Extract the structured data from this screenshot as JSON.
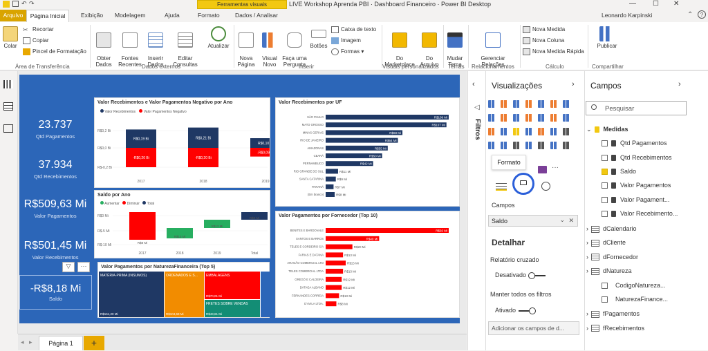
{
  "window": {
    "title": "LIVE Workshop Aprenda PBI · Dashboard Financeiro · Power BI Desktop",
    "context_tab": "Ferramentas visuais",
    "user": "Leonardo Karpinski"
  },
  "tabs": [
    "Arquivo",
    "Página Inicial",
    "Exibição",
    "Modelagem",
    "Ajuda",
    "Formato",
    "Dados / Analisar"
  ],
  "ribbon": {
    "paste": "Colar",
    "cut": "Recortar",
    "copy": "Copiar",
    "format_painter": "Pincel de Formatação",
    "get_data": "Obter\nDados",
    "recent_sources": "Fontes\nRecentes",
    "enter_data": "Inserir\nDados",
    "edit_queries": "Editar\nConsultas",
    "refresh": "Atualizar",
    "new_page": "Nova\nPágina",
    "new_visual": "Visual\nNovo",
    "ask_question": "Faça uma\nPergunta",
    "buttons": "Botões",
    "text_box": "Caixa de texto",
    "image": "Imagem",
    "shapes": "Formas",
    "from_marketplace": "Do\nMarketplace",
    "from_file": "Do\nArquivo",
    "switch_theme": "Mudar\nTema",
    "manage_relationships": "Gerenciar\nRelações",
    "new_measure": "Nova Medida",
    "new_column": "Nova Coluna",
    "quick_measure": "Nova Medida Rápida",
    "publish": "Publicar",
    "groups": [
      "Área de Transferência",
      "Dados externos",
      "Inserir",
      "Visuais personalizados",
      "Temas",
      "Relacionamentos",
      "Cálculo",
      "Compartilhar"
    ]
  },
  "kpis": [
    {
      "value": "23.737",
      "label": "Qtd Pagamentos"
    },
    {
      "value": "37.934",
      "label": "Qtd Recebimentos"
    },
    {
      "value": "R$509,63 Mi",
      "label": "Valor Pagamentos"
    },
    {
      "value": "R$501,45 Mi",
      "label": "Valor Recebimentos"
    },
    {
      "value": "-R$8,18 Mi",
      "label": "Saldo"
    }
  ],
  "chart_data": [
    {
      "type": "bar",
      "title": "Valor Recebimentos e Valor Pagamentos Negativo por Ano",
      "categories": [
        "2017",
        "2018",
        "2019"
      ],
      "legend": [
        "Valor Recebimentos",
        "Valor Pagamentos Negativo"
      ],
      "series": [
        {
          "name": "Valor Recebimentos",
          "values": [
            0.19,
            0.21,
            0.1
          ],
          "labels": [
            "R$0,19 Bi",
            "R$0,21 Bi",
            "R$0,10 Bi"
          ],
          "color": "#1f3864"
        },
        {
          "name": "Valor Pagamentos Negativo",
          "values": [
            -0.2,
            -0.2,
            -0.09
          ],
          "labels": [
            "-R$0,20 Bi",
            "-R$0,20 Bi",
            "-R$0,09 Bi"
          ],
          "color": "#ff0000"
        }
      ],
      "yticks": [
        "R$0,2 Bi",
        "R$0,0 Bi",
        "R$-0,2 Bi"
      ]
    },
    {
      "type": "bar",
      "title": "Valor Recebimentos por UF",
      "orientation": "horizontal",
      "categories": [
        "SÃO PAULO",
        "MATO GROSSO",
        "MINAS GERAIS",
        "RIO DE JANEIRO",
        "AMAZONAS",
        "CEARÁ",
        "PERNAMBUCO",
        "RIO GRANDE DO SUL",
        "SANTA CATARINA",
        "PARANÁ",
        "(Em branco)"
      ],
      "values": [
        109,
        107,
        68,
        64,
        55,
        50,
        42,
        11,
        9,
        7,
        8
      ],
      "labels": [
        "R$109 Mi",
        "R$107 Mi",
        "R$68 Mi",
        "R$64 Mi",
        "R$55 Mi",
        "R$50 Mi",
        "R$42 Mi",
        "R$11 Mi",
        "R$9 Mi",
        "R$7 Mi",
        "R$8 Mi"
      ],
      "color": "#1f3864"
    },
    {
      "type": "waterfall",
      "title": "Saldo por Ano",
      "legend": [
        "Aumentar",
        "Diminuir",
        "Total"
      ],
      "categories": [
        "2017",
        "2018",
        "2019",
        "Total"
      ],
      "yticks": [
        "R$0 Mi",
        "R$-5 Mi",
        "R$-10 Mi"
      ],
      "labels": [
        "R$8 Mi",
        "R$13 Mi",
        "R$13 Mi",
        "R$8 Mi"
      ]
    },
    {
      "type": "bar",
      "title": "Valor Pagamentos por Fornecedor (Top 10)",
      "orientation": "horizontal",
      "categories": [
        "BENITES E BARDOVALE",
        "SANTOS E BARROS",
        "TELES E CORDEIRO S/A",
        "FARIAS E DATANA",
        "ARAGÃO COMERCIAL LTD",
        "TELES COMERCIAL LTDA",
        "GREGÓ E CALDEIRA",
        "DATAGA ALBANO",
        "FERNANDES CORREIA",
        "D'AVILA LTDA."
      ],
      "values": [
        92,
        40,
        20,
        13,
        15,
        13,
        12,
        12,
        10,
        8
      ],
      "labels": [
        "R$92 Mi",
        "R$40 Mi",
        "R$20 Mi",
        "R$13 Mi",
        "R$15 Mi",
        "R$13 Mi",
        "R$12 Mi",
        "R$12 Mi",
        "R$10 Mi",
        "R$8 Mi"
      ],
      "color": "#ff0000"
    },
    {
      "type": "treemap",
      "title": "Valor Pagamentos por NaturezaFinanceira (Top 5)",
      "items": [
        {
          "label": "MATÉRIA-PRIMA (INSUMOS)",
          "value": "R$161,20 Mi",
          "color": "#1f3864"
        },
        {
          "label": "ORDENADOS E S...",
          "value": "R$104,69 Mi",
          "color": "#f28c00"
        },
        {
          "label": "EMBALAGENS",
          "value": "R$70,01 Mi",
          "color": "#ff0000"
        },
        {
          "label": "FRETES SOBRE VENDAS",
          "value": "R$43,61 Mi",
          "color": "#138d75"
        },
        {
          "label": "",
          "value": "",
          "color": "#2c66b8"
        }
      ]
    }
  ],
  "page_tab": "Página 1",
  "add_page": "+",
  "filters_label": "Filtros",
  "viz_pane": {
    "title": "Visualizações",
    "tooltip": "Formato",
    "fields_label": "Campos",
    "field_value": "Saldo",
    "drill_title": "Detalhar",
    "cross_report": "Relatório cruzado",
    "cross_state": "Desativado",
    "keep_filters": "Manter todos os filtros",
    "keep_state": "Ativado",
    "add_drill": "Adicionar os campos de d..."
  },
  "fields_pane": {
    "title": "Campos",
    "search_placeholder": "Pesquisar",
    "items": [
      {
        "type": "group",
        "label": "Medidas"
      },
      {
        "type": "measure",
        "label": "Qtd Pagamentos"
      },
      {
        "type": "measure",
        "label": "Qtd Recebimentos"
      },
      {
        "type": "measure",
        "label": "Saldo",
        "checked": true
      },
      {
        "type": "measure",
        "label": "Valor Pagamentos"
      },
      {
        "type": "measure",
        "label": "Valor Pagament..."
      },
      {
        "type": "measure",
        "label": "Valor Recebimento..."
      },
      {
        "type": "table",
        "label": "dCalendario"
      },
      {
        "type": "table",
        "label": "dCliente"
      },
      {
        "type": "table",
        "label": "dFornecedor"
      },
      {
        "type": "table",
        "label": "dNatureza"
      },
      {
        "type": "field",
        "label": "CodigoNatureza..."
      },
      {
        "type": "field",
        "label": "NaturezaFinance..."
      },
      {
        "type": "table",
        "label": "fPagamentos"
      },
      {
        "type": "table",
        "label": "fRecebimentos"
      }
    ]
  }
}
